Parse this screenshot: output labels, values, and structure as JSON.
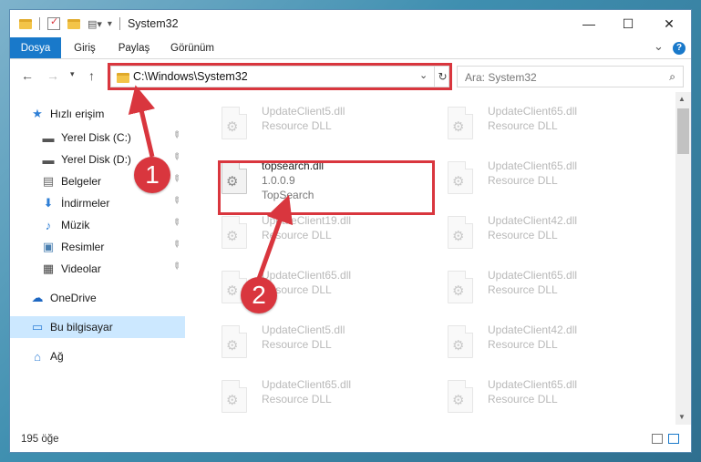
{
  "window": {
    "title": "System32",
    "controls": {
      "minimize": "—",
      "maximize": "☐",
      "close": "✕"
    }
  },
  "ribbon": {
    "tabs": [
      {
        "label": "Dosya",
        "active": true
      },
      {
        "label": "Giriş",
        "active": false
      },
      {
        "label": "Paylaş",
        "active": false
      },
      {
        "label": "Görünüm",
        "active": false
      }
    ],
    "collapse": "⌄",
    "help": "?"
  },
  "nav": {
    "back": "←",
    "forward": "→",
    "up": "↑",
    "address": "C:\\Windows\\System32",
    "address_dropdown": "⌄",
    "refresh": "↻",
    "search_placeholder": "Ara: System32",
    "search_icon": "⌕"
  },
  "sidebar": {
    "items": [
      {
        "label": "Hızlı erişim",
        "icon": "star-icon",
        "glyph": "★",
        "color": "#2f7fd6"
      },
      {
        "label": "Yerel Disk (C:)",
        "icon": "drive-icon",
        "glyph": "▬",
        "color": "#555555",
        "pinned": true
      },
      {
        "label": "Yerel Disk (D:)",
        "icon": "drive-icon",
        "glyph": "▬",
        "color": "#555555",
        "pinned": true
      },
      {
        "label": "Belgeler",
        "icon": "documents-icon",
        "glyph": "▤",
        "color": "#666666",
        "pinned": true
      },
      {
        "label": "İndirmeler",
        "icon": "download-icon",
        "glyph": "⬇",
        "color": "#2f7fd6",
        "pinned": true
      },
      {
        "label": "Müzik",
        "icon": "music-icon",
        "glyph": "♪",
        "color": "#2f7fd6",
        "pinned": true
      },
      {
        "label": "Resimler",
        "icon": "pictures-icon",
        "glyph": "▣",
        "color": "#4a7fb0",
        "pinned": true
      },
      {
        "label": "Videolar",
        "icon": "video-icon",
        "glyph": "▦",
        "color": "#444444",
        "pinned": true
      },
      {
        "label": "OneDrive",
        "icon": "cloud-icon",
        "glyph": "☁",
        "color": "#1d67c2"
      },
      {
        "label": "Bu bilgisayar",
        "icon": "computer-icon",
        "glyph": "▭",
        "color": "#2f7fd6",
        "selected": true
      },
      {
        "label": "Ağ",
        "icon": "network-icon",
        "glyph": "⌂",
        "color": "#2f7fd6"
      }
    ],
    "pin_glyph": "📌"
  },
  "files": {
    "left": [
      {
        "name": "UpdateClient5.dll",
        "type": "Resource DLL",
        "faded": true
      },
      {
        "name": "topsearch.dll",
        "version": "1.0.0.9",
        "type": "TopSearch",
        "faded": false
      },
      {
        "name": "UpdateClient19.dll",
        "type": "Resource DLL",
        "faded": true
      },
      {
        "name": "UpdateClient65.dll",
        "type": "Resource DLL",
        "faded": true
      },
      {
        "name": "UpdateClient5.dll",
        "type": "Resource DLL",
        "faded": true
      },
      {
        "name": "UpdateClient65.dll",
        "type": "Resource DLL",
        "faded": true
      }
    ],
    "right": [
      {
        "name": "UpdateClient65.dll",
        "type": "Resource DLL",
        "faded": true
      },
      {
        "name": "UpdateClient65.dll",
        "type": "Resource DLL",
        "faded": true
      },
      {
        "name": "UpdateClient42.dll",
        "type": "Resource DLL",
        "faded": true
      },
      {
        "name": "UpdateClient65.dll",
        "type": "Resource DLL",
        "faded": true
      },
      {
        "name": "UpdateClient42.dll",
        "type": "Resource DLL",
        "faded": true
      },
      {
        "name": "UpdateClient65.dll",
        "type": "Resource DLL",
        "faded": true
      }
    ],
    "gear_glyph": "⚙"
  },
  "status": {
    "count": "195 öğe"
  },
  "callouts": {
    "step1": "1",
    "step2": "2",
    "color": "#d9363e"
  }
}
